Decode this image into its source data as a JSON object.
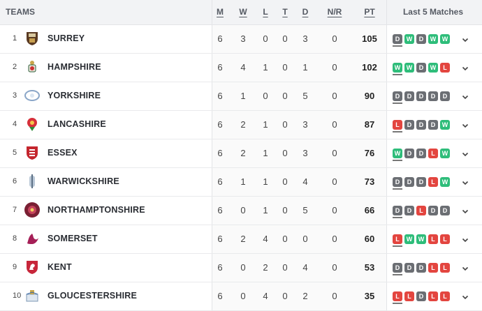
{
  "headers": {
    "teams": "TEAMS",
    "m": "M",
    "w": "W",
    "l": "L",
    "t": "T",
    "d": "D",
    "nr": "N/R",
    "pt": "PT",
    "last5": "Last 5 Matches"
  },
  "colors": {
    "W": "#2ebd7a",
    "D": "#6b6e73",
    "L": "#e3453f"
  },
  "rows": [
    {
      "rank": "1",
      "team": "SURREY",
      "m": "6",
      "w": "3",
      "l": "0",
      "t": "0",
      "d": "3",
      "nr": "0",
      "pt": "105",
      "form": [
        "D",
        "W",
        "D",
        "W",
        "W"
      ],
      "icon": "surrey-crest-icon"
    },
    {
      "rank": "2",
      "team": "HAMPSHIRE",
      "m": "6",
      "w": "4",
      "l": "1",
      "t": "0",
      "d": "1",
      "nr": "0",
      "pt": "102",
      "form": [
        "W",
        "W",
        "D",
        "W",
        "L"
      ],
      "icon": "hampshire-crest-icon"
    },
    {
      "rank": "3",
      "team": "YORKSHIRE",
      "m": "6",
      "w": "1",
      "l": "0",
      "t": "0",
      "d": "5",
      "nr": "0",
      "pt": "90",
      "form": [
        "D",
        "D",
        "D",
        "D",
        "D"
      ],
      "icon": "yorkshire-crest-icon"
    },
    {
      "rank": "4",
      "team": "LANCASHIRE",
      "m": "6",
      "w": "2",
      "l": "1",
      "t": "0",
      "d": "3",
      "nr": "0",
      "pt": "87",
      "form": [
        "L",
        "D",
        "D",
        "D",
        "W"
      ],
      "icon": "lancashire-rose-icon"
    },
    {
      "rank": "5",
      "team": "ESSEX",
      "m": "6",
      "w": "2",
      "l": "1",
      "t": "0",
      "d": "3",
      "nr": "0",
      "pt": "76",
      "form": [
        "W",
        "D",
        "D",
        "L",
        "W"
      ],
      "icon": "essex-crest-icon"
    },
    {
      "rank": "6",
      "team": "WARWICKSHIRE",
      "m": "6",
      "w": "1",
      "l": "1",
      "t": "0",
      "d": "4",
      "nr": "0",
      "pt": "73",
      "form": [
        "D",
        "D",
        "D",
        "L",
        "W"
      ],
      "icon": "warwickshire-bear-icon"
    },
    {
      "rank": "7",
      "team": "NORTHAMPTONSHIRE",
      "m": "6",
      "w": "0",
      "l": "1",
      "t": "0",
      "d": "5",
      "nr": "0",
      "pt": "66",
      "form": [
        "D",
        "D",
        "L",
        "D",
        "D"
      ],
      "icon": "northamptonshire-rose-icon"
    },
    {
      "rank": "8",
      "team": "SOMERSET",
      "m": "6",
      "w": "2",
      "l": "4",
      "t": "0",
      "d": "0",
      "nr": "0",
      "pt": "60",
      "form": [
        "L",
        "W",
        "W",
        "L",
        "L"
      ],
      "icon": "somerset-wyvern-icon"
    },
    {
      "rank": "9",
      "team": "KENT",
      "m": "6",
      "w": "0",
      "l": "2",
      "t": "0",
      "d": "4",
      "nr": "0",
      "pt": "53",
      "form": [
        "D",
        "D",
        "D",
        "L",
        "L"
      ],
      "icon": "kent-horse-icon"
    },
    {
      "rank": "10",
      "team": "GLOUCESTERSHIRE",
      "m": "6",
      "w": "0",
      "l": "4",
      "t": "0",
      "d": "2",
      "nr": "0",
      "pt": "35",
      "form": [
        "L",
        "L",
        "D",
        "L",
        "L"
      ],
      "icon": "gloucestershire-crest-icon"
    }
  ]
}
